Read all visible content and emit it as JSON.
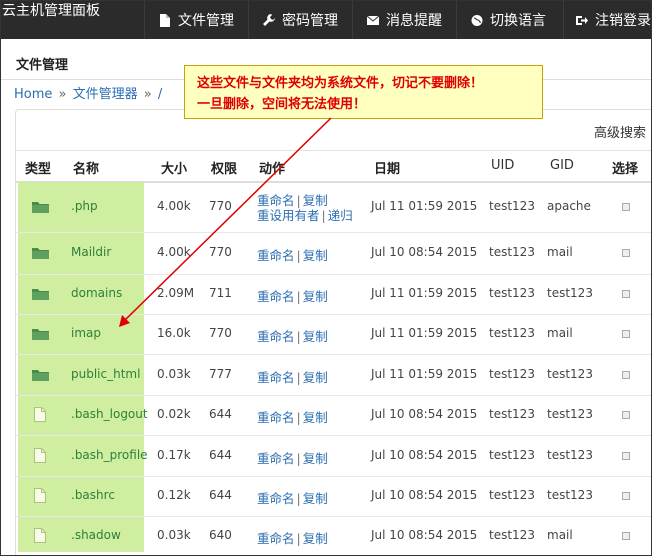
{
  "app": {
    "brand": "云主机管理面板"
  },
  "nav": [
    {
      "label": "文件管理",
      "icon": "file-icon"
    },
    {
      "label": "密码管理",
      "icon": "wrench-icon"
    },
    {
      "label": "消息提醒",
      "icon": "envelope-icon"
    },
    {
      "label": "切换语言",
      "icon": "globe-icon"
    },
    {
      "label": "注销登录",
      "icon": "logout-icon"
    }
  ],
  "page": {
    "title": "文件管理"
  },
  "breadcrumb": {
    "home": "Home",
    "sep": "»",
    "manager": "文件管理器",
    "sep2": "»",
    "path": "/"
  },
  "toolbar": {
    "advanced_search": "高级搜索"
  },
  "columns": {
    "type": "类型",
    "name": "名称",
    "size": "大小",
    "perm": "权限",
    "action": "动作",
    "date": "日期",
    "uid": "UID",
    "gid": "GID",
    "select": "选择"
  },
  "actions": {
    "rename": "重命名",
    "copy": "复制",
    "set_owner": "重设用有者",
    "recursive": "递归",
    "pipe": "|"
  },
  "rows": [
    {
      "kind": "folder",
      "name": ".php",
      "size": "4.00k",
      "perm": "770",
      "date": "Jul 11 01:59 2015",
      "uid": "test123",
      "gid": "apache"
    },
    {
      "kind": "folder",
      "name": "Maildir",
      "size": "4.00k",
      "perm": "770",
      "date": "Jul 10 08:54 2015",
      "uid": "test123",
      "gid": "mail"
    },
    {
      "kind": "folder",
      "name": "domains",
      "size": "2.09M",
      "perm": "711",
      "date": "Jul 11 01:59 2015",
      "uid": "test123",
      "gid": "test123"
    },
    {
      "kind": "folder",
      "name": "imap",
      "size": "16.0k",
      "perm": "770",
      "date": "Jul 11 01:59 2015",
      "uid": "test123",
      "gid": "mail"
    },
    {
      "kind": "folder",
      "name": "public_html",
      "size": "0.03k",
      "perm": "777",
      "date": "Jul 11 01:59 2015",
      "uid": "test123",
      "gid": "test123"
    },
    {
      "kind": "file",
      "name": ".bash_logout",
      "size": "0.02k",
      "perm": "644",
      "date": "Jul 10 08:54 2015",
      "uid": "test123",
      "gid": "test123"
    },
    {
      "kind": "file",
      "name": ".bash_profile",
      "size": "0.17k",
      "perm": "644",
      "date": "Jul 10 08:54 2015",
      "uid": "test123",
      "gid": "test123"
    },
    {
      "kind": "file",
      "name": ".bashrc",
      "size": "0.12k",
      "perm": "644",
      "date": "Jul 10 08:54 2015",
      "uid": "test123",
      "gid": "test123"
    },
    {
      "kind": "file",
      "name": ".shadow",
      "size": "0.03k",
      "perm": "640",
      "date": "Jul 10 08:54 2015",
      "uid": "test123",
      "gid": "mail"
    }
  ],
  "callout": {
    "line1": "这些文件与文件夹均为系统文件，切记不要删除！",
    "line2": "一旦删除，空间将无法使用！"
  },
  "colors": {
    "topbar": "#2b2b2b",
    "highlight": "#cfeea0",
    "link": "#2a6eb2",
    "callout_bg": "#ffffc0",
    "callout_text": "#e00000",
    "arrow": "#e00000"
  }
}
